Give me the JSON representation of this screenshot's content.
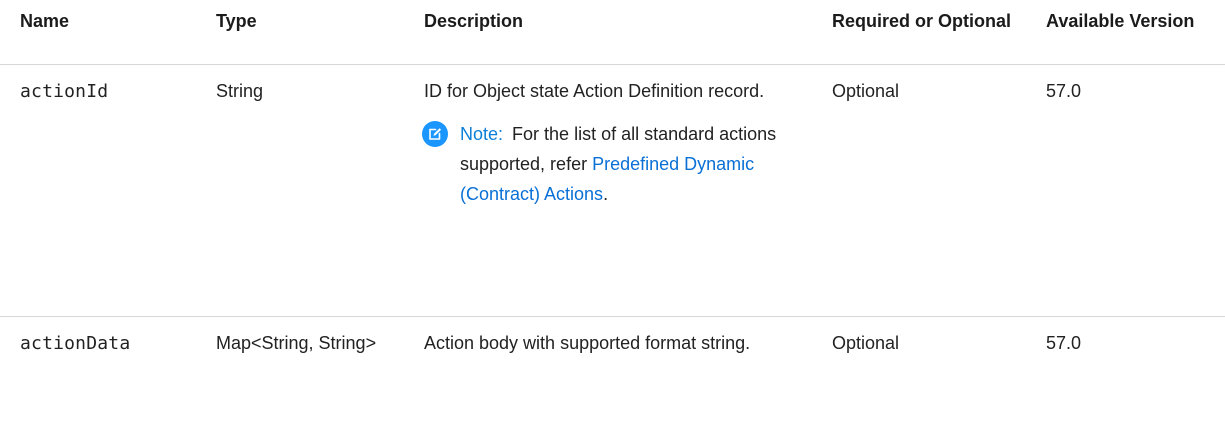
{
  "table": {
    "headers": {
      "name": "Name",
      "type": "Type",
      "description": "Description",
      "required": "Required or Optional",
      "version": "Available Version"
    },
    "rows": [
      {
        "name": "actionId",
        "type": "String",
        "description": "ID for Object state Action Definition record.",
        "note": {
          "label": "Note:",
          "text": "For the list of all standard actions supported, refer",
          "link_text": "Predefined Dynamic (Contract) Actions",
          "suffix": "."
        },
        "required": "Optional",
        "version": "57.0"
      },
      {
        "name": "actionData",
        "type": "Map<String, String>",
        "description": "Action body with supported format string.",
        "required": "Optional",
        "version": "57.0"
      }
    ]
  },
  "icons": {
    "note_icon": "pencil-edit-icon",
    "note_icon_color": "#1b96ff"
  },
  "colors": {
    "link": "#0a70d6",
    "note_label": "#0b7fd8",
    "divider": "#d8d8d8"
  }
}
